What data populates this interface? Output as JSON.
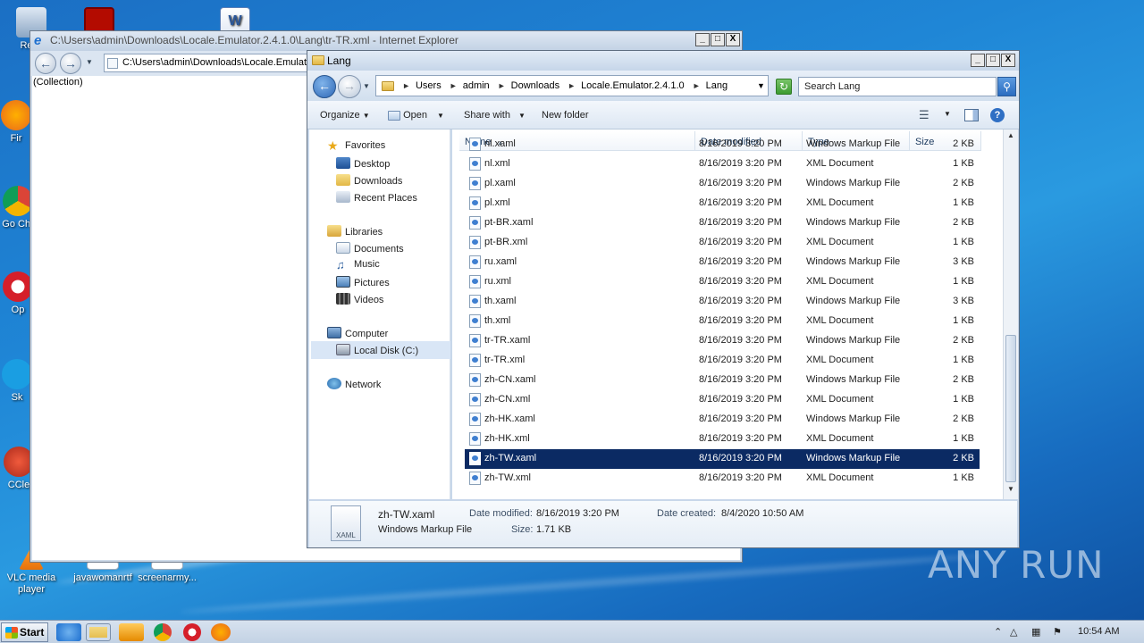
{
  "desktop": {
    "icons": [
      {
        "label": "Recy",
        "color": "#9bb7d6"
      },
      {
        "label": "Fir",
        "color": "#e8661c"
      },
      {
        "label": "Go Chr",
        "color": "#2f9b46"
      },
      {
        "label": "Op",
        "color": "#d51f2a"
      },
      {
        "label": "Sk",
        "color": "#1a9ee2"
      },
      {
        "label": "CCle",
        "color": "#c93c2a"
      },
      {
        "label": "VLC media player",
        "color": "#f08a0c"
      },
      {
        "label": "javawomanrtf",
        "color": "#ffffff"
      },
      {
        "label": "screenarmy...",
        "color": "#ffffff"
      }
    ],
    "watermark": "ANY RUN"
  },
  "ie_window": {
    "title": "C:\\Users\\admin\\Downloads\\Locale.Emulator.2.4.1.0\\Lang\\tr-TR.xml - Internet Explorer",
    "address": "C:\\Users\\admin\\Downloads\\Locale.Emulato",
    "content": "(Collection)",
    "buttons": {
      "minimize": "_",
      "maximize": "□",
      "close": "X"
    }
  },
  "explorer": {
    "title": "Lang",
    "breadcrumb": [
      "Users",
      "admin",
      "Downloads",
      "Locale.Emulator.2.4.1.0",
      "Lang"
    ],
    "search_placeholder": "Search Lang",
    "commands": {
      "organize": "Organize",
      "open": "Open",
      "share_with": "Share with",
      "new_folder": "New folder"
    },
    "tree": {
      "favorites": "Favorites",
      "desktop": "Desktop",
      "downloads": "Downloads",
      "recent_places": "Recent Places",
      "libraries": "Libraries",
      "documents": "Documents",
      "music": "Music",
      "pictures": "Pictures",
      "videos": "Videos",
      "computer": "Computer",
      "local_disk": "Local Disk (C:)",
      "network": "Network"
    },
    "columns": {
      "name": "Name",
      "date": "Date modified",
      "type": "Type",
      "size": "Size"
    },
    "files": [
      {
        "name": "nl.xaml",
        "date": "8/16/2019 3:20 PM",
        "type": "Windows Markup File",
        "size": "2 KB"
      },
      {
        "name": "nl.xml",
        "date": "8/16/2019 3:20 PM",
        "type": "XML Document",
        "size": "1 KB"
      },
      {
        "name": "pl.xaml",
        "date": "8/16/2019 3:20 PM",
        "type": "Windows Markup File",
        "size": "2 KB"
      },
      {
        "name": "pl.xml",
        "date": "8/16/2019 3:20 PM",
        "type": "XML Document",
        "size": "1 KB"
      },
      {
        "name": "pt-BR.xaml",
        "date": "8/16/2019 3:20 PM",
        "type": "Windows Markup File",
        "size": "2 KB"
      },
      {
        "name": "pt-BR.xml",
        "date": "8/16/2019 3:20 PM",
        "type": "XML Document",
        "size": "1 KB"
      },
      {
        "name": "ru.xaml",
        "date": "8/16/2019 3:20 PM",
        "type": "Windows Markup File",
        "size": "3 KB"
      },
      {
        "name": "ru.xml",
        "date": "8/16/2019 3:20 PM",
        "type": "XML Document",
        "size": "1 KB"
      },
      {
        "name": "th.xaml",
        "date": "8/16/2019 3:20 PM",
        "type": "Windows Markup File",
        "size": "3 KB"
      },
      {
        "name": "th.xml",
        "date": "8/16/2019 3:20 PM",
        "type": "XML Document",
        "size": "1 KB"
      },
      {
        "name": "tr-TR.xaml",
        "date": "8/16/2019 3:20 PM",
        "type": "Windows Markup File",
        "size": "2 KB"
      },
      {
        "name": "tr-TR.xml",
        "date": "8/16/2019 3:20 PM",
        "type": "XML Document",
        "size": "1 KB"
      },
      {
        "name": "zh-CN.xaml",
        "date": "8/16/2019 3:20 PM",
        "type": "Windows Markup File",
        "size": "2 KB"
      },
      {
        "name": "zh-CN.xml",
        "date": "8/16/2019 3:20 PM",
        "type": "XML Document",
        "size": "1 KB"
      },
      {
        "name": "zh-HK.xaml",
        "date": "8/16/2019 3:20 PM",
        "type": "Windows Markup File",
        "size": "2 KB"
      },
      {
        "name": "zh-HK.xml",
        "date": "8/16/2019 3:20 PM",
        "type": "XML Document",
        "size": "1 KB"
      },
      {
        "name": "zh-TW.xaml",
        "date": "8/16/2019 3:20 PM",
        "type": "Windows Markup File",
        "size": "2 KB",
        "selected": true
      },
      {
        "name": "zh-TW.xml",
        "date": "8/16/2019 3:20 PM",
        "type": "XML Document",
        "size": "1 KB"
      }
    ],
    "details": {
      "filename": "zh-TW.xaml",
      "filetype": "Windows Markup File",
      "icon_label": "XAML",
      "date_modified_label": "Date modified:",
      "date_modified": "8/16/2019 3:20 PM",
      "date_created_label": "Date created:",
      "date_created": "8/4/2020 10:50 AM",
      "size_label": "Size:",
      "size": "1.71 KB"
    }
  },
  "taskbar": {
    "start": "Start",
    "clock": "10:54 AM"
  }
}
